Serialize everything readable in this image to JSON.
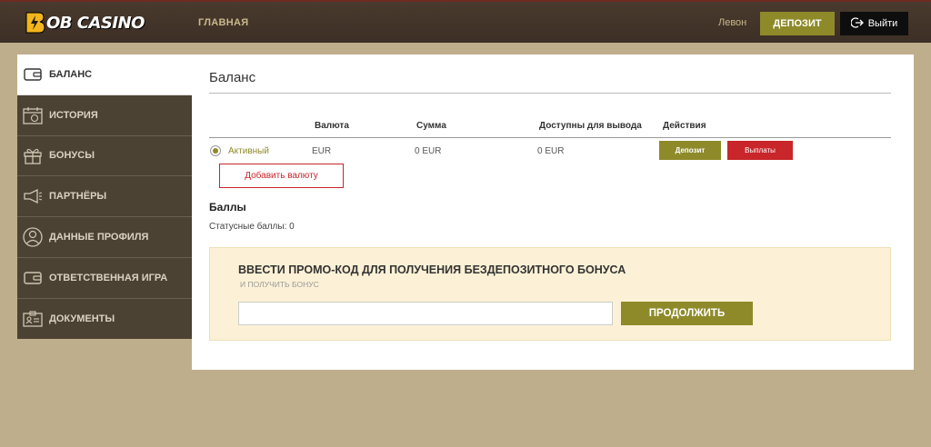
{
  "header": {
    "logo_text": "OB CASINO",
    "nav_main": "ГЛАВНАЯ",
    "user_name": "Левон",
    "deposit_label": "ДЕПОЗИТ",
    "logout_label": "Выйти",
    "accent_color": "#8e8a2a",
    "header_color": "#3c2f25"
  },
  "sidebar": {
    "items": [
      {
        "label": "БАЛАНС",
        "icon": "wallet-icon",
        "active": true
      },
      {
        "label": "ИСТОРИЯ",
        "icon": "calendar-icon",
        "active": false
      },
      {
        "label": "БОНУСЫ",
        "icon": "gift-icon",
        "active": false
      },
      {
        "label": "ПАРТНЁРЫ",
        "icon": "megaphone-icon",
        "active": false
      },
      {
        "label": "ДАННЫЕ ПРОФИЛЯ",
        "icon": "user-icon",
        "active": false
      },
      {
        "label": "ОТВЕТСТВЕННАЯ ИГРА",
        "icon": "wallet-icon",
        "active": false
      },
      {
        "label": "ДОКУМЕНТЫ",
        "icon": "id-card-icon",
        "active": false
      }
    ]
  },
  "main": {
    "title": "Баланс",
    "table": {
      "headers": [
        "Валюта",
        "Сумма",
        "Доступны для вывода",
        "Действия"
      ],
      "row": {
        "status": "Активный",
        "currency": "EUR",
        "amount": "0 EUR",
        "withdrawable": "0 EUR",
        "deposit_label": "Депозит",
        "payout_label": "Выплаты"
      }
    },
    "add_currency_label": "Добавить валюту",
    "points": {
      "title": "Баллы",
      "status_text": "Статусные баллы: 0"
    },
    "promo": {
      "title": "ВВЕСТИ ПРОМО-КОД ДЛЯ ПОЛУЧЕНИЯ БЕЗДЕПОЗИТНОГО БОНУСА",
      "subtitle": "И ПОЛУЧИТЬ БОНУС",
      "input_value": "",
      "continue_label": "ПРОДОЛЖИТЬ"
    }
  }
}
